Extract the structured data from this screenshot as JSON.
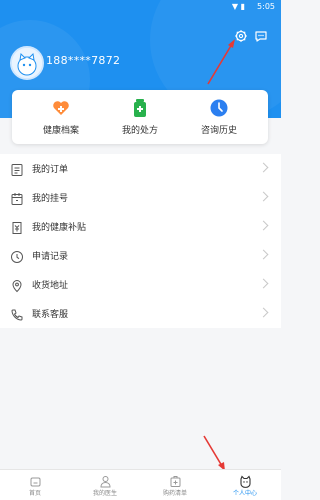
{
  "status_bar": {
    "time": "5:05"
  },
  "profile": {
    "phone": "188****7872"
  },
  "quick_actions": [
    {
      "label": "健康档案",
      "icon": "health-record-icon",
      "color": "#ff8c3a"
    },
    {
      "label": "我的处方",
      "icon": "prescription-icon",
      "color": "#28b14c"
    },
    {
      "label": "咨询历史",
      "icon": "consult-history-icon",
      "color": "#2b7ff0"
    }
  ],
  "menu": [
    {
      "label": "我的订单",
      "icon": "order-icon"
    },
    {
      "label": "我的挂号",
      "icon": "registration-icon"
    },
    {
      "label": "我的健康补贴",
      "icon": "subsidy-icon"
    },
    {
      "label": "申请记录",
      "icon": "clock-icon"
    },
    {
      "label": "收货地址",
      "icon": "location-icon"
    },
    {
      "label": "联系客服",
      "icon": "phone-icon"
    }
  ],
  "tabbar": [
    {
      "label": "首页",
      "icon": "home-icon"
    },
    {
      "label": "我的医生",
      "icon": "doctor-icon"
    },
    {
      "label": "购药清单",
      "icon": "medicine-list-icon"
    },
    {
      "label": "个人中心",
      "icon": "profile-icon",
      "active": true
    }
  ],
  "colors": {
    "primary": "#1e90f0",
    "annotation_red": "#e53935"
  }
}
